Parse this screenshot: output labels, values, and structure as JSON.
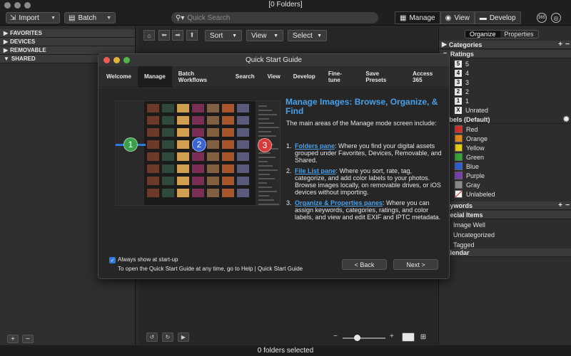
{
  "window": {
    "title": "[0 Folders]"
  },
  "toolbar": {
    "import_label": "Import",
    "batch_label": "Batch",
    "search_placeholder": "Quick Search",
    "modes": {
      "manage": "Manage",
      "view": "View",
      "develop": "Develop"
    },
    "access_badge": "365"
  },
  "folders_pane": {
    "sections": [
      "FAVORITES",
      "DEVICES",
      "REMOVABLE",
      "SHARED"
    ]
  },
  "center_toolbar": {
    "sort_label": "Sort",
    "view_label": "View",
    "select_label": "Select"
  },
  "statusbar": {
    "text": "0 folders selected"
  },
  "right_pane": {
    "tabs": [
      "Organize",
      "Properties"
    ],
    "categories_header": "Categories",
    "ratings_header": "Ratings",
    "ratings": [
      {
        "badge": "5",
        "label": "5"
      },
      {
        "badge": "4",
        "label": "4"
      },
      {
        "badge": "3",
        "label": "3"
      },
      {
        "badge": "2",
        "label": "2"
      },
      {
        "badge": "1",
        "label": "1"
      },
      {
        "badge": "X",
        "label": "Unrated"
      }
    ],
    "labels_header": "Labels (Default)",
    "labels": [
      {
        "name": "Red",
        "color": "#d0312d"
      },
      {
        "name": "Orange",
        "color": "#e58a1f"
      },
      {
        "name": "Yellow",
        "color": "#e7d21b"
      },
      {
        "name": "Green",
        "color": "#36a83a"
      },
      {
        "name": "Blue",
        "color": "#2f5fd1"
      },
      {
        "name": "Purple",
        "color": "#7a3fb0"
      },
      {
        "name": "Gray",
        "color": "#8c8c8c"
      },
      {
        "name": "Unlabeled",
        "color": "#ffffff"
      }
    ],
    "keywords_header": "Keywords",
    "special_header": "Special Items",
    "special_items": [
      "Image Well",
      "Uncategorized",
      "Tagged"
    ],
    "calendar_header": "Calendar"
  },
  "dialog": {
    "title": "Quick Start Guide",
    "tabs": [
      "Welcome",
      "Manage",
      "Batch Workflows",
      "Search",
      "View",
      "Develop",
      "Fine-tune",
      "Save Presets",
      "Access 365"
    ],
    "active_tab": "Manage",
    "heading": "Manage Images: Browse, Organize, & Find",
    "intro": "The main areas of the Manage mode screen include:",
    "items": [
      {
        "num": "1.",
        "link": "Folders pane",
        "text": ": Where you find your digital assets grouped under Favorites, Devices, Removable, and Shared."
      },
      {
        "num": "2.",
        "link": "File List pane",
        "text": ": Where you sort, rate, tag, categorize, and add color labels to your photos. Browse images locally, on removable drives, or iOS devices without importing."
      },
      {
        "num": "3.",
        "link": "Organize & Properties panes",
        "text": ": Where you can assign keywords, categories, ratings, and color labels, and view and edit EXIF and IPTC metadata."
      }
    ],
    "callouts": [
      "1",
      "2",
      "3"
    ],
    "always_show_label": "Always show at start-up",
    "help_text": "To open the Quick Start Guide at any time, go to Help | Quick Start Guide",
    "back_label": "< Back",
    "next_label": "Next >"
  }
}
